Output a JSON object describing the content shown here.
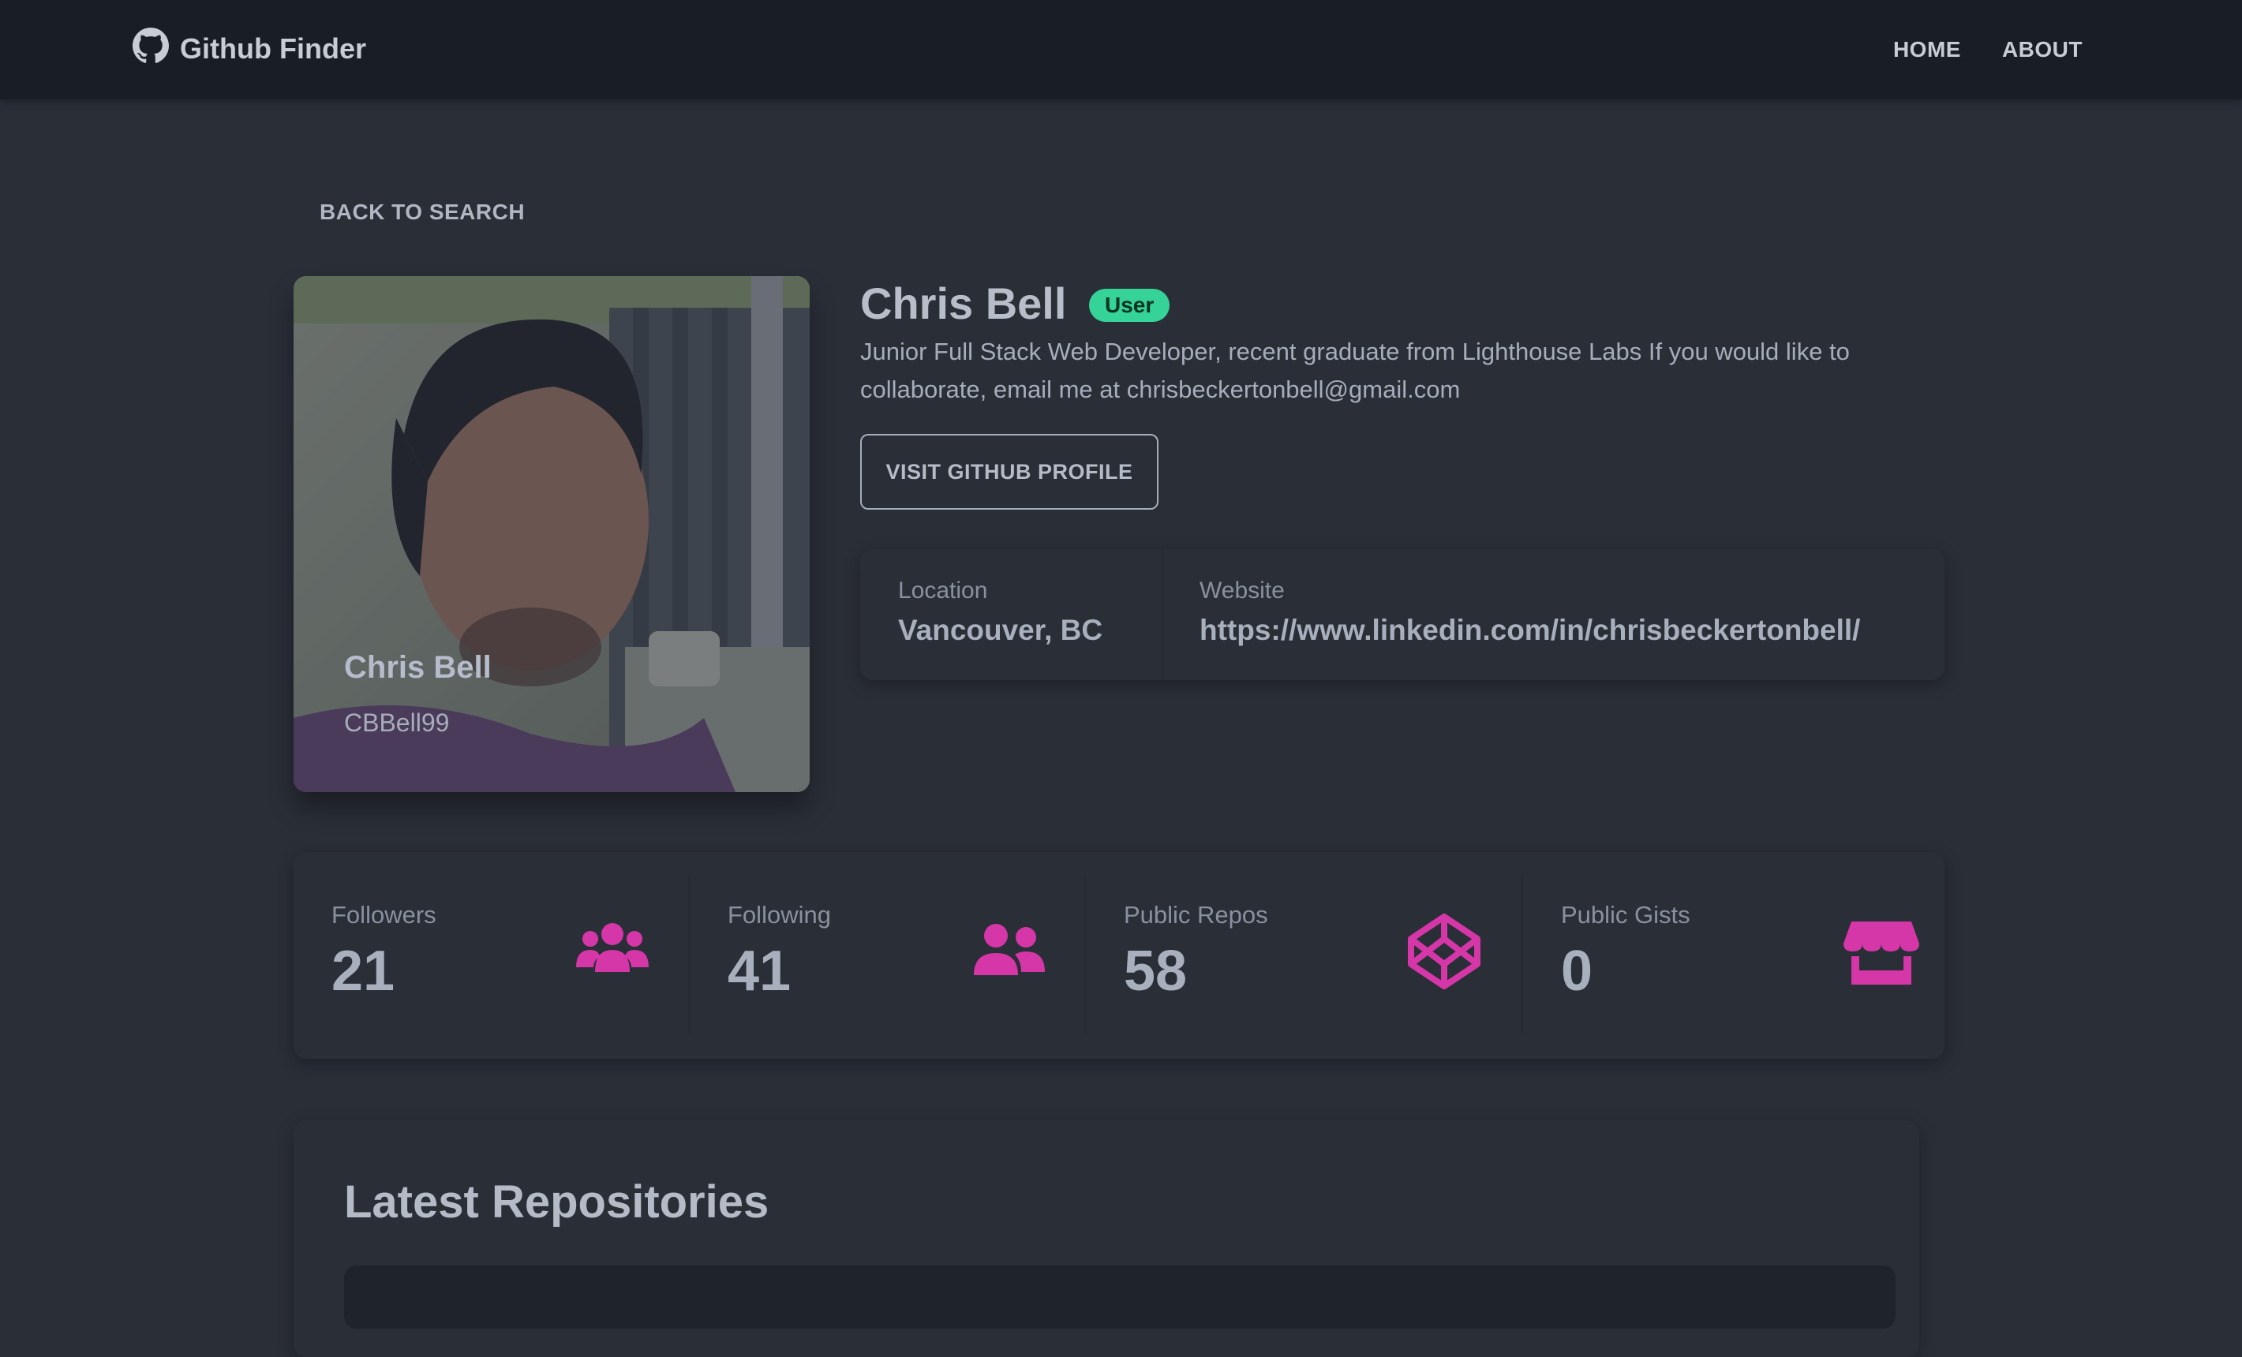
{
  "navbar": {
    "brand": "Github Finder",
    "brand_icon": "github-icon",
    "links": [
      "HOME",
      "ABOUT"
    ]
  },
  "back_link": "BACK TO SEARCH",
  "profile": {
    "name": "Chris Bell",
    "login": "CBBell99",
    "type_badge": "User",
    "bio": "Junior Full Stack Web Developer, recent graduate from Lighthouse Labs If you would like to collaborate, email me at chrisbeckertonbell@gmail.com",
    "visit_button": "VISIT GITHUB PROFILE",
    "location_label": "Location",
    "location": "Vancouver, BC",
    "website_label": "Website",
    "website": "https://www.linkedin.com/in/chrisbeckertonbell/"
  },
  "stats": [
    {
      "label": "Followers",
      "value": "21",
      "icon": "users-icon"
    },
    {
      "label": "Following",
      "value": "41",
      "icon": "user-friends-icon"
    },
    {
      "label": "Public Repos",
      "value": "58",
      "icon": "codepen-icon"
    },
    {
      "label": "Public Gists",
      "value": "0",
      "icon": "store-icon"
    }
  ],
  "repos": {
    "title": "Latest Repositories"
  },
  "colors": {
    "accent": "#d536a8",
    "badge": "#36d399",
    "background": "#2a2e37",
    "navbar": "#191d24"
  }
}
